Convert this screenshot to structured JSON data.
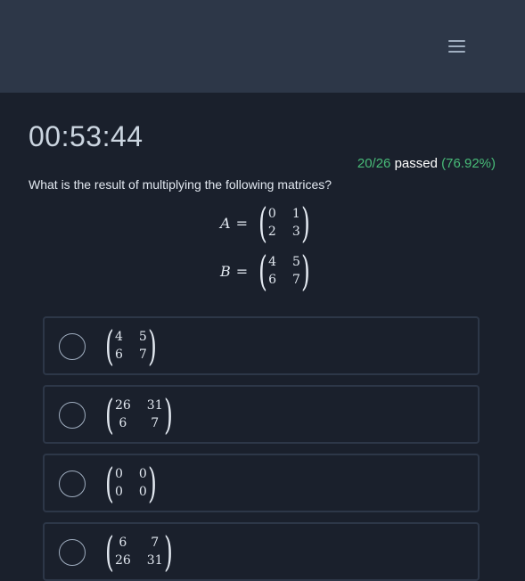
{
  "header": {
    "menu_icon": "hamburger-menu-icon"
  },
  "timer": "00:53:44",
  "stats": {
    "passed": "20/26",
    "label": "passed",
    "percent": "(76.92%)"
  },
  "question": {
    "text": "What is the result of multiplying the following matrices?",
    "matrices": [
      {
        "name": "A",
        "eq": "=",
        "rows": [
          [
            "0",
            "1"
          ],
          [
            "2",
            "3"
          ]
        ]
      },
      {
        "name": "B",
        "eq": "=",
        "rows": [
          [
            "4",
            "5"
          ],
          [
            "6",
            "7"
          ]
        ]
      }
    ]
  },
  "options": [
    {
      "rows": [
        [
          "4",
          "5"
        ],
        [
          "6",
          "7"
        ]
      ]
    },
    {
      "rows": [
        [
          "26",
          "31"
        ],
        [
          "6",
          "7"
        ]
      ]
    },
    {
      "rows": [
        [
          "0",
          "0"
        ],
        [
          "0",
          "0"
        ]
      ]
    },
    {
      "rows": [
        [
          "6",
          "7"
        ],
        [
          "26",
          "31"
        ]
      ]
    }
  ],
  "colors": {
    "background": "#1a202c",
    "header": "#2d3748",
    "accent_green": "#48bb78"
  }
}
